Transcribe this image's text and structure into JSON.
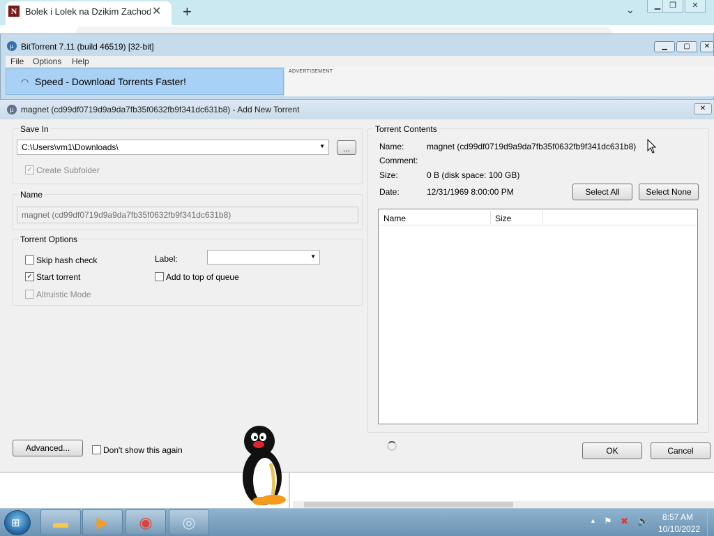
{
  "chrome": {
    "tab_title": "Bolek i Lolek na Dzikim Zachodzie",
    "tab_favicon": "N",
    "tab_close_icon": "close-icon",
    "new_tab_icon": "plus-icon"
  },
  "app": {
    "title": "BitTorrent 7.11  (build 46519) [32-bit]",
    "menu": [
      "File",
      "Options",
      "Help"
    ],
    "banner_text": "Speed - Download Torrents Faster!",
    "ad_label": "ADVERTISEMENT"
  },
  "dialog": {
    "title": "magnet (cd99df0719d9a9da7fb35f0632fb9f341dc631b8) - Add New Torrent",
    "save_in": {
      "label": "Save In",
      "path": "C:\\Users\\vm1\\Downloads\\",
      "browse_label": "...",
      "create_subfolder_label": "Create Subfolder",
      "create_subfolder_checked": true
    },
    "name": {
      "label": "Name",
      "value": "magnet (cd99df0719d9a9da7fb35f0632fb9f341dc631b8)"
    },
    "options": {
      "label": "Torrent Options",
      "skip_hash_label": "Skip hash check",
      "skip_hash_checked": false,
      "start_torrent_label": "Start torrent",
      "start_torrent_checked": true,
      "altruistic_label": "Altruistic Mode",
      "altruistic_checked": false,
      "label_field_label": "Label:",
      "label_value": "",
      "add_top_label": "Add to top of queue",
      "add_top_checked": false
    },
    "contents": {
      "label": "Torrent Contents",
      "name_key": "Name:",
      "name_val": "magnet (cd99df0719d9a9da7fb35f0632fb9f341dc631b8)",
      "comment_key": "Comment:",
      "comment_val": "",
      "size_key": "Size:",
      "size_val": "0 B (disk space: 100 GB)",
      "date_key": "Date:",
      "date_val": "12/31/1969 8:00:00 PM",
      "select_all_label": "Select All",
      "select_none_label": "Select None",
      "columns": [
        "Name",
        "Size"
      ]
    },
    "advanced_label": "Advanced...",
    "dont_show_label": "Don't show this again",
    "dont_show_checked": false,
    "ok_label": "OK",
    "cancel_label": "Cancel"
  },
  "taskbar": {
    "apps": [
      "file-explorer-icon",
      "media-player-icon",
      "chrome-icon",
      "bittorrent-icon"
    ],
    "clock_time": "8:57 AM",
    "clock_date": "10/10/2022"
  },
  "colors": {
    "banner_bg": "#a8d1f5",
    "taskbar": "#7ea4c2",
    "dialog_bg": "#f0f0f0"
  }
}
